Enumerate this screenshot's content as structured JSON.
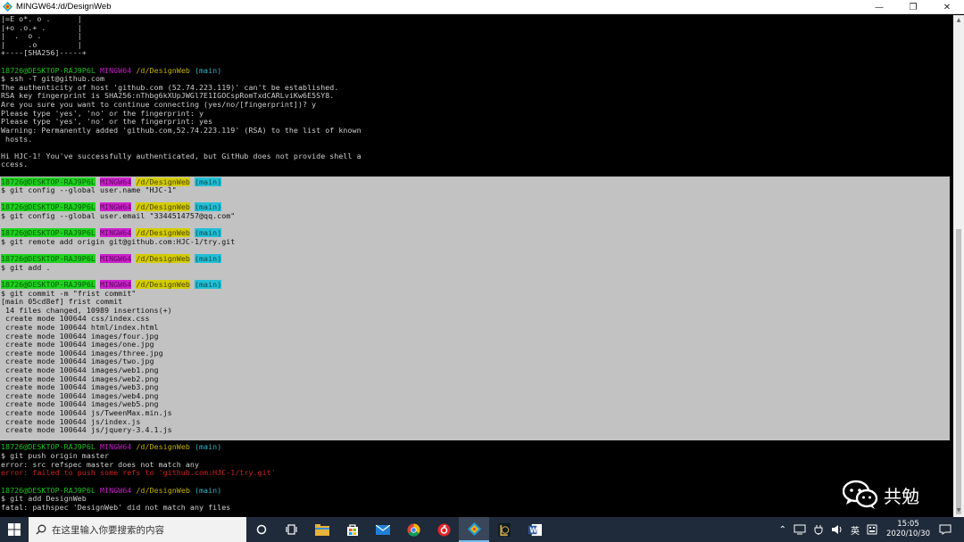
{
  "window": {
    "title": "MINGW64:/d/DesignWeb",
    "minimize": "—",
    "maximize": "❐",
    "close": "✕"
  },
  "prompt": {
    "user": "18726@DESKTOP-RAJ9P6L",
    "host": "MINGW64",
    "path": "/d/DesignWeb",
    "branch": "(main)"
  },
  "terminal_top": [
    "|=E o*. o .      |",
    "|+o .o.+ .       |",
    "|  .  o .        |",
    "|     .o         |",
    "+----[SHA256]-----+",
    "",
    "$PROMPT",
    "$ ssh -T git@github.com",
    "The authenticity of host 'github.com (52.74.223.119)' can't be established.",
    "RSA key fingerprint is SHA256:nThbg6kXUpJWGl7E1IGOCspRomTxdCARLviKw6E5SY8.",
    "Are you sure you want to continue connecting (yes/no/[fingerprint])? y",
    "Please type 'yes', 'no' or the fingerprint: y",
    "Please type 'yes', 'no' or the fingerprint: yes",
    "Warning: Permanently added 'github.com,52.74.223.119' (RSA) to the list of known",
    " hosts.",
    "",
    "Hi HJC-1! You've successfully authenticated, but GitHub does not provide shell a",
    "ccess.",
    ""
  ],
  "terminal_selected": [
    "$PROMPT",
    "$ git config --global user.name \"HJC-1\"",
    "",
    "$PROMPT",
    "$ git config --global user.email \"3344514757@qq.com\"",
    "",
    "$PROMPT",
    "$ git remote add origin git@github.com:HJC-1/try.git",
    "",
    "$PROMPT",
    "$ git add .",
    "",
    "$PROMPT",
    "$ git commit -m \"frist commit\"",
    "[main 05cd8ef] frist commit",
    " 14 files changed, 10989 insertions(+)",
    " create mode 100644 css/index.css",
    " create mode 100644 html/index.html",
    " create mode 100644 images/four.jpg",
    " create mode 100644 images/one.jpg",
    " create mode 100644 images/three.jpg",
    " create mode 100644 images/two.jpg",
    " create mode 100644 images/web1.png",
    " create mode 100644 images/web2.png",
    " create mode 100644 images/web3.png",
    " create mode 100644 images/web4.png",
    " create mode 100644 images/web5.png",
    " create mode 100644 js/TweenMax.min.js",
    " create mode 100644 js/index.js",
    " create mode 100644 js/jquery-3.4.1.js",
    ""
  ],
  "terminal_bottom": [
    "$PROMPT",
    "$ git push origin master",
    "error: src refspec master does not match any",
    "$ERR:error: failed to push some refs to 'github.com:HJC-1/try.git'",
    "",
    "$PROMPT",
    "$ git add DesignWeb",
    "fatal: pathspec 'DesignWeb' did not match any files"
  ],
  "watermark": {
    "text": "共勉"
  },
  "taskbar": {
    "search_placeholder": "在这里输入你要搜索的内容",
    "ime": "英",
    "time": "15:05",
    "date": "2020/10/30"
  }
}
